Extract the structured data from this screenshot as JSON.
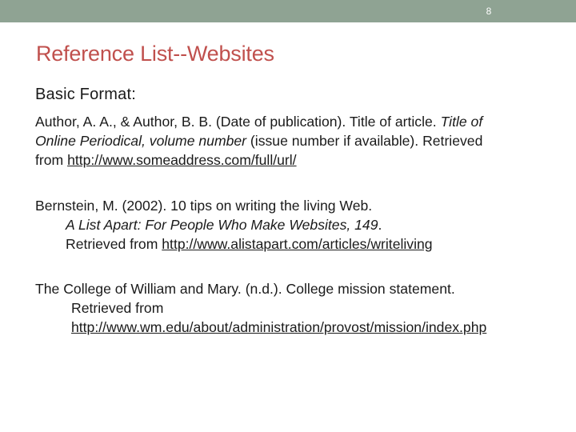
{
  "slide": {
    "number": "8",
    "title": "Reference List--Websites",
    "subheading": "Basic Format:",
    "accent_color": "#c0504d",
    "band_color": "#8fa393"
  },
  "format_entry": {
    "line1_text": "Author, A. A., & Author, B. B. (Date of publication). Title of article. ",
    "line1_italic": "Title of",
    "line2_italic": "Online Periodical, volume number",
    "line2_text": " (issue number if available). Retrieved",
    "line3_text": "from ",
    "line3_link": "http://www.someaddress.com/full/url/"
  },
  "example1": {
    "line1": "Bernstein, M. (2002). 10 tips on writing the living Web.",
    "line2_italic": "A List Apart: For People Who Make Websites, 149",
    "line2_text": ".",
    "line3_text": "Retrieved from ",
    "line3_link": "http://www.alistapart.com/articles/writeliving"
  },
  "example2": {
    "line1": "The College of William and Mary. (n.d.). College mission statement.",
    "line2": "Retrieved from",
    "line3_link": "http://www.wm.edu/about/administration/provost/mission/index.php"
  }
}
